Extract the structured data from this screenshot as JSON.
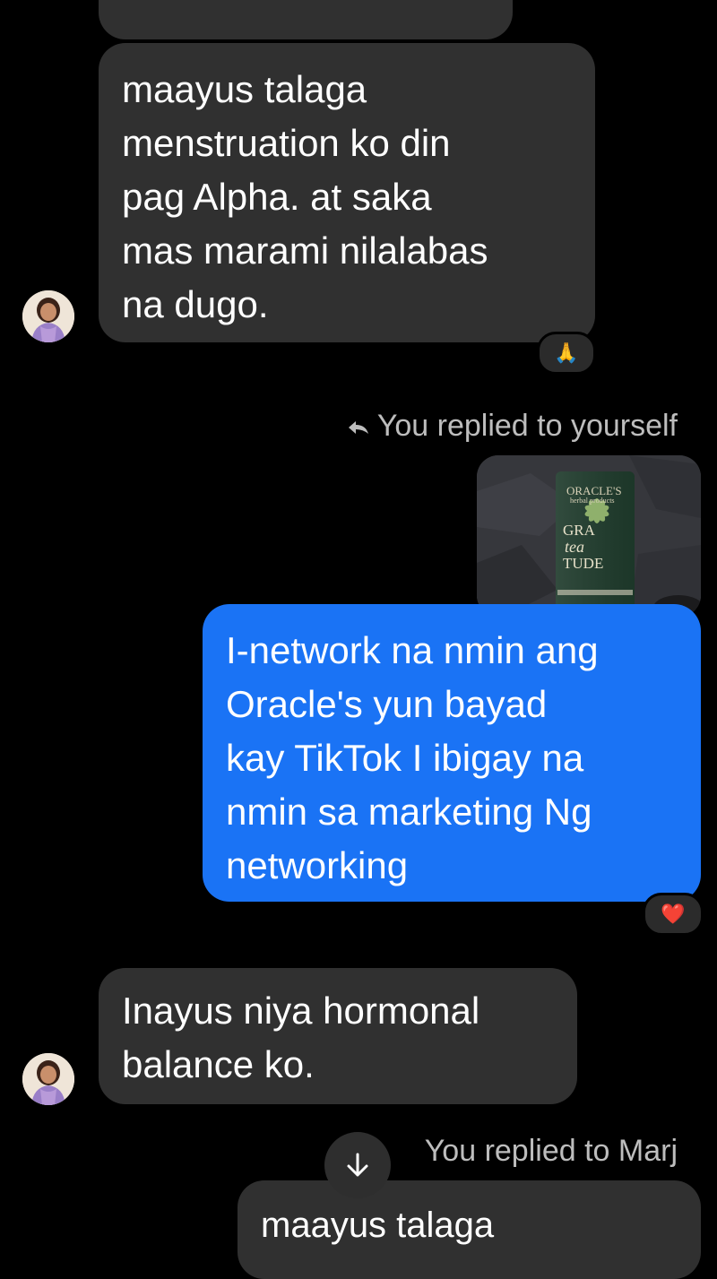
{
  "messages": {
    "m1": {
      "lines": [
        "maayus talaga",
        "menstruation ko din",
        "pag Alpha. at saka",
        "mas marami nilalabas",
        "na dugo."
      ],
      "reaction": "🙏"
    },
    "reply1": {
      "text": "You replied to yourself"
    },
    "photo": {
      "brand": "ORACLE'S",
      "brand_sub": "herbal products",
      "name_line1": "GRA",
      "name_line2": "tea",
      "name_line3": "TUDE"
    },
    "m2": {
      "lines": [
        "I-network na nmin ang",
        "Oracle's yun bayad",
        "kay TikTok I ibigay na",
        "nmin sa marketing Ng",
        "networking"
      ],
      "reaction": "❤️"
    },
    "m3": {
      "lines": [
        "Inayus niya hormonal",
        "balance ko."
      ]
    },
    "reply2": {
      "text": "You replied to Marj"
    },
    "m4": {
      "preview": "maayus talaga"
    }
  },
  "colors": {
    "incoming_bubble": "#303030",
    "outgoing_bubble": "#1a73f5",
    "background": "#000000"
  },
  "icons": {
    "reply": "reply-arrow-icon",
    "scroll": "arrow-down-icon",
    "avatar": "contact-avatar"
  }
}
